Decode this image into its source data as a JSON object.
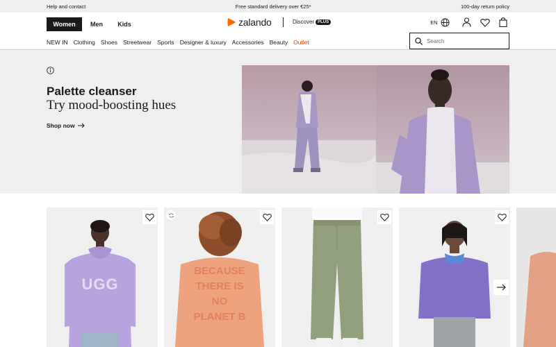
{
  "topbar": {
    "help": "Help and contact",
    "delivery": "Free standard delivery over €25*",
    "returns": "100-day return policy"
  },
  "header": {
    "genders": [
      "Women",
      "Men",
      "Kids"
    ],
    "logo_text": "zalando",
    "discover": "Discover",
    "plus": "PLUS",
    "language": "EN"
  },
  "nav": {
    "items": [
      "NEW IN",
      "Clothing",
      "Shoes",
      "Streetwear",
      "Sports",
      "Designer & luxury",
      "Accessories",
      "Beauty",
      "Outlet"
    ]
  },
  "search": {
    "placeholder": "Search"
  },
  "hero": {
    "title": "Palette cleanser",
    "subtitle": "Try mood-boosting hues",
    "cta": "Shop now"
  },
  "colors": {
    "brand_orange": "#ff6900",
    "outlet_red": "#d24100",
    "hero_bg": "#efeff0",
    "dark": "#1a1a1a"
  },
  "products": [
    {
      "item": "lilac-hoodie",
      "print": "UGG"
    },
    {
      "item": "peach-sweatshirt",
      "print": "BECAUSE THERE IS NO PLANET B"
    },
    {
      "item": "khaki-trousers"
    },
    {
      "item": "purple-knit-cardigan"
    }
  ]
}
